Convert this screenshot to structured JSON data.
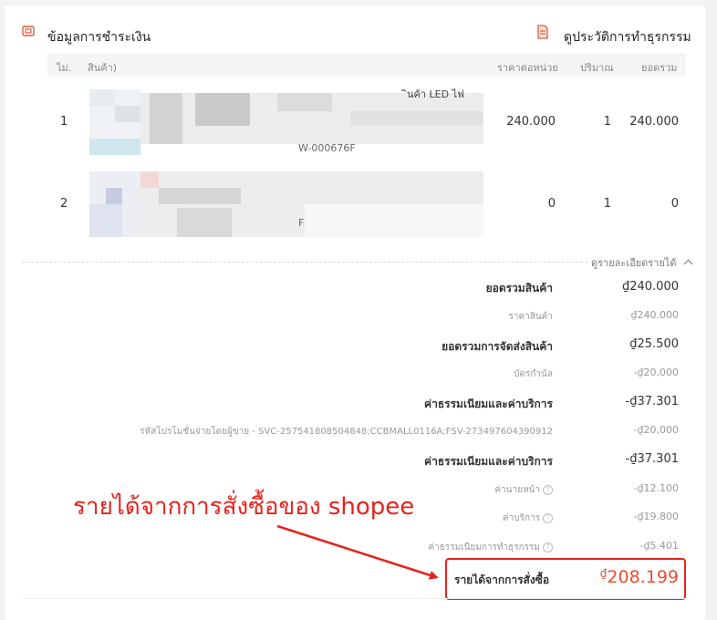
{
  "payment_section": {
    "title": "ข้อมูลการชำระเงิน",
    "history_link": "ดูประวัติการทำธุรกรรม",
    "icon": "wallet-icon",
    "history_icon": "document-icon"
  },
  "table": {
    "headers": {
      "no": "ไม่.",
      "product": "สินค้า)",
      "unit_price": "ราคาต่อหน่วย",
      "qty": "ปริมาณ",
      "total": "ยอดรวม"
    },
    "rows": [
      {
        "no": "1",
        "name_fragment": "ินค้า LED ไฟ",
        "sku_fragment": "W-000676F",
        "unit_price": "240.000",
        "qty": "1",
        "total": "240.000"
      },
      {
        "no": "2",
        "name_fragment": "",
        "sku_fragment": "F",
        "unit_price": "0",
        "qty": "1",
        "total": "0"
      }
    ]
  },
  "income_details": {
    "toggle_label": "ดูรายละเอียดรายได้",
    "rows": [
      {
        "label": "ยอดรวมสินค้า",
        "value": "₫240.000",
        "style": "bold"
      },
      {
        "label": "ราคาสินค้า",
        "value": "₫240.000",
        "style": "sub"
      },
      {
        "label": "ยอดรวมการจัดส่งสินค้า",
        "value": "₫25.500",
        "style": "bold"
      },
      {
        "label": "บัตรกำนัล",
        "value": "-₫20,000",
        "style": "sub"
      },
      {
        "label": "ค่าธรรมเนียมและค่าบริการ",
        "value": "-₫37.301",
        "style": "bold"
      },
      {
        "label": "รหัสโปรโมชั่นจ่ายโดยผู้ขาย - SVC-257541808504848;CCBMALL0116A;FSV-273497604390912",
        "value": "-₫20,000",
        "style": "sub"
      },
      {
        "label": "ค่าธรรมเนียมและค่าบริการ",
        "value": "-₫37.301",
        "style": "bold"
      },
      {
        "label": "ค่านายหน้า",
        "value": "-₫12.100",
        "style": "sub-help"
      },
      {
        "label": "ค่าบริการ",
        "value": "-₫19.800",
        "style": "sub-help"
      },
      {
        "label": "ค่าธรรมเนียมการทำธุรกรรม",
        "value": "-₫5.401",
        "style": "sub-help"
      }
    ],
    "final": {
      "label": "รายได้จากการสั่งซื้อ",
      "currency": "₫",
      "amount": "208.199"
    }
  },
  "annotation": {
    "text": "รายได้จากการสั่งซื้อของ shopee",
    "color": "#e8211b"
  }
}
